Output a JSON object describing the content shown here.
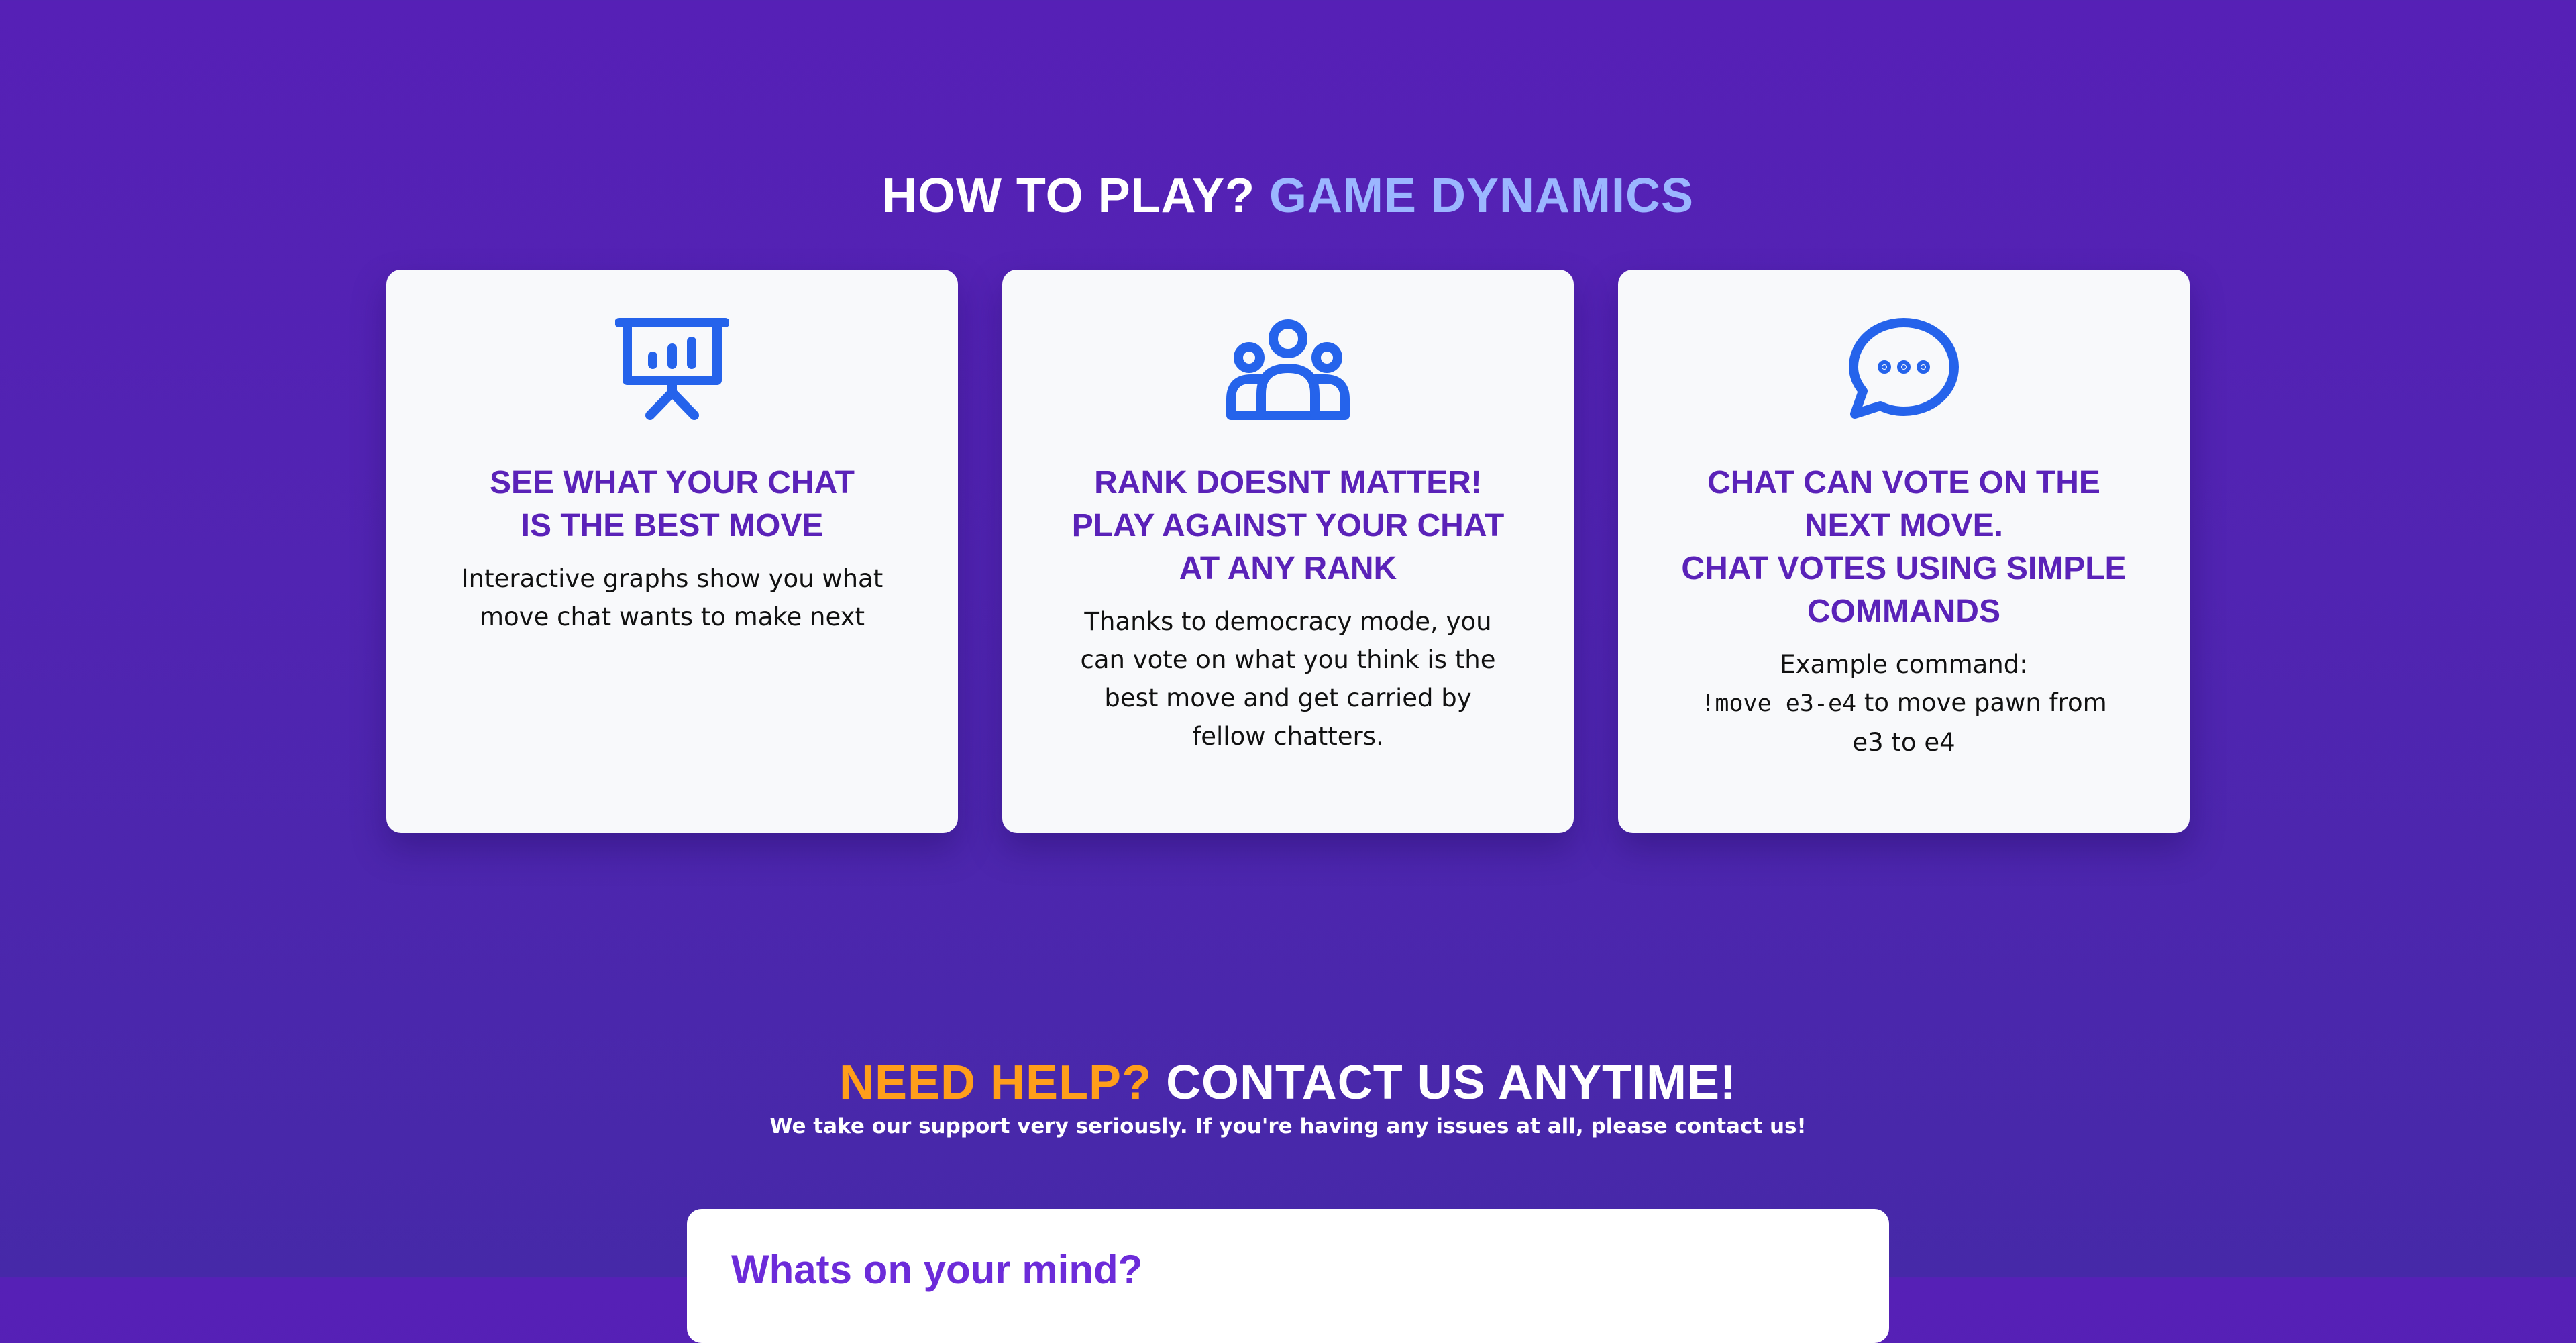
{
  "how_to_play": {
    "heading_white": "HOW TO PLAY?",
    "heading_accent": "GAME DYNAMICS",
    "accent_color": "#9bb6ff"
  },
  "cards": [
    {
      "icon": "presentation-chart-icon",
      "title_line1": "SEE WHAT YOUR CHAT",
      "title_line2": "IS THE BEST MOVE",
      "text_line1": "Interactive graphs show you what",
      "text_line2": "move chat wants to make next"
    },
    {
      "icon": "user-group-icon",
      "title_line1": "RANK DOESNT MATTER!",
      "title_line2": "PLAY AGAINST YOUR CHAT",
      "title_line3": "AT ANY RANK",
      "text_line1": "Thanks to democracy mode, you",
      "text_line2": "can vote on what you think is the",
      "text_line3": "best move and get carried by",
      "text_line4": "fellow chatters."
    },
    {
      "icon": "chat-bubble-icon",
      "title_line1": "CHAT CAN VOTE ON THE",
      "title_line2": "NEXT MOVE.",
      "title_line3": "CHAT VOTES USING SIMPLE",
      "title_line4": "COMMANDS",
      "text_line1": "Example command:",
      "command": "!move e3-e4",
      "text_line2_rest": " to move pawn from",
      "text_line3": "e3 to e4"
    }
  ],
  "help": {
    "heading_accent": "NEED HELP?",
    "heading_white": "CONTACT US ANYTIME!",
    "accent_color": "#ff9e1b",
    "subtext": "We take our support very seriously. If you're having any issues at all, please contact us!"
  },
  "contact_form": {
    "title": "Whats on your mind?"
  },
  "colors": {
    "background": "#5620b6",
    "card_title": "#5a22b8",
    "icon_blue": "#2563eb"
  }
}
